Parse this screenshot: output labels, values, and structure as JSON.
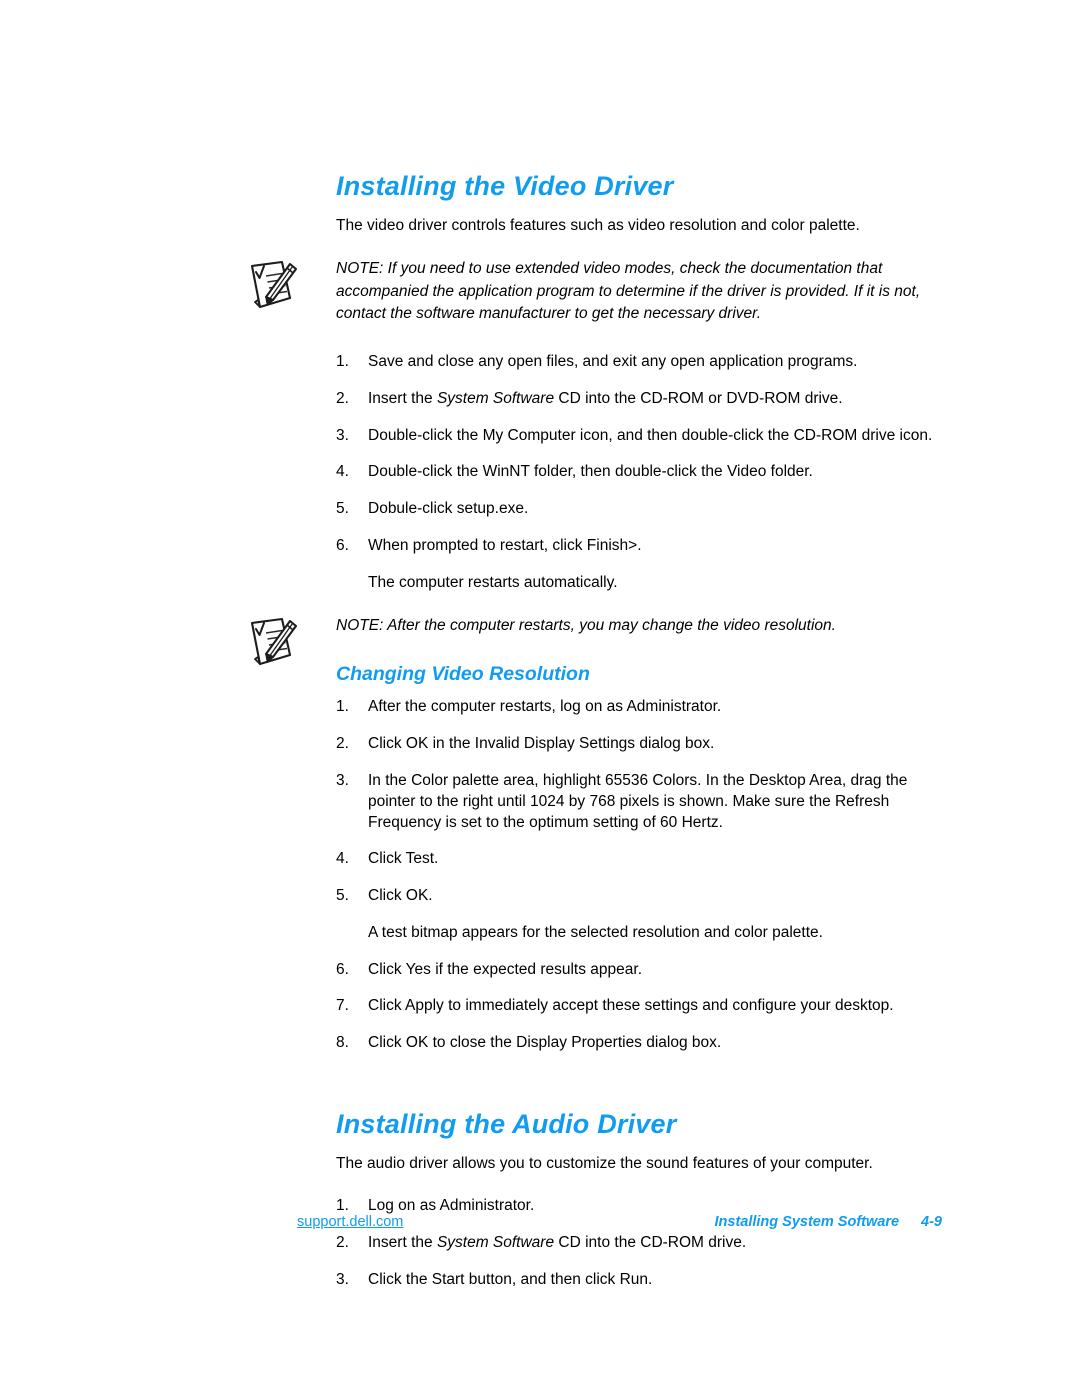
{
  "page": {
    "heading_color": "#109cf1",
    "body_color": "#000000"
  },
  "sections": [
    {
      "title": "Installing the Video Driver",
      "intro": "The video driver controls features such as video resolution and color palette.",
      "note": "NOTE: If you need to use extended video modes, check the documentation that accompanied the application program to determine if the driver is provided. If it is not, contact the software manufacturer to get the necessary driver.",
      "note_icon": "note-pencil-icon",
      "steps": [
        {
          "num": "1.",
          "pre": "Save and close any open files, and exit any open application programs.",
          "em": "",
          "post": ""
        },
        {
          "num": "2.",
          "pre": "Insert the ",
          "em": "System Software",
          "post": " CD into the CD-ROM or DVD-ROM drive."
        },
        {
          "num": "3.",
          "pre": "Double-click the My Computer icon, and then double-click the CD-ROM drive icon.",
          "em": "",
          "post": ""
        },
        {
          "num": "4.",
          "pre": "Double-click the WinNT folder, then double-click the Video folder.",
          "em": "",
          "post": ""
        },
        {
          "num": "5.",
          "pre": "Dobule-click setup.exe.",
          "em": "",
          "post": ""
        },
        {
          "num": "6.",
          "pre": "When prompted to restart, click Finish>.",
          "em": "",
          "post": "",
          "sub": "The computer restarts automatically."
        }
      ]
    }
  ],
  "note2": {
    "text": "NOTE: After the computer restarts, you may change the video resolution.",
    "icon": "note-pencil-icon"
  },
  "subsection": {
    "title": "Changing Video Resolution",
    "steps": [
      {
        "num": "1.",
        "pre": "After the computer restarts, log on as Administrator.",
        "em": "",
        "post": ""
      },
      {
        "num": "2.",
        "pre": "Click OK in the Invalid Display Settings dialog box.",
        "em": "",
        "post": ""
      },
      {
        "num": "3.",
        "pre": "In the Color palette area, highlight 65536 Colors. In the Desktop Area, drag the pointer to the right until 1024 by 768 pixels is shown. Make sure the Refresh Frequency is set to the optimum setting of 60 Hertz.",
        "em": "",
        "post": ""
      },
      {
        "num": "4.",
        "pre": "Click Test.",
        "em": "",
        "post": ""
      },
      {
        "num": "5.",
        "pre": "Click OK.",
        "em": "",
        "post": "",
        "sub": "A test bitmap appears for the selected resolution and color palette."
      },
      {
        "num": "6.",
        "pre": "Click Yes if the expected results appear.",
        "em": "",
        "post": ""
      },
      {
        "num": "7.",
        "pre": "Click Apply to immediately accept these settings and configure your desktop.",
        "em": "",
        "post": ""
      },
      {
        "num": "8.",
        "pre": "Click OK to close the Display Properties dialog box.",
        "em": "",
        "post": ""
      }
    ]
  },
  "audio": {
    "title": "Installing the Audio Driver",
    "intro": "The audio driver allows you to customize the sound features of your computer.",
    "steps": [
      {
        "num": "1.",
        "pre": "Log on as Administrator.",
        "em": "",
        "post": ""
      },
      {
        "num": "2.",
        "pre": "Insert the ",
        "em": "System Software",
        "post": " CD into the CD-ROM drive."
      },
      {
        "num": "3.",
        "pre": "Click the Start button, and then click Run.",
        "em": "",
        "post": ""
      }
    ]
  },
  "footer": {
    "link": "support.dell.com",
    "chapter": "Installing System Software",
    "page_number": "4-9"
  }
}
